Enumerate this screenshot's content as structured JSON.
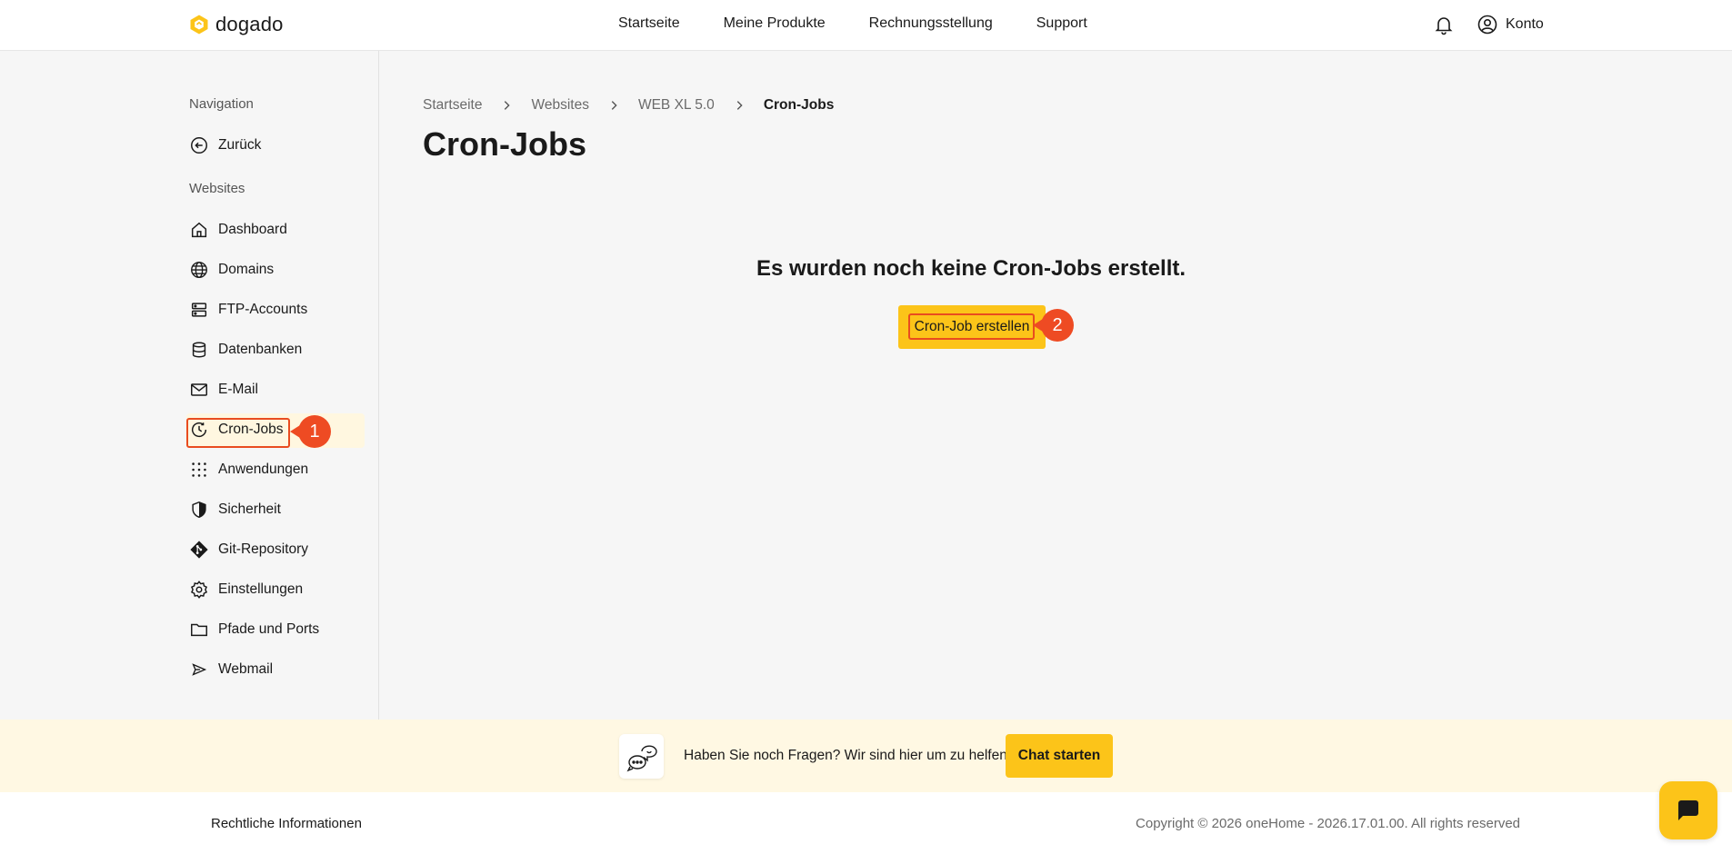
{
  "brand": {
    "name": "dogado",
    "accent": "#fcc419",
    "highlight": "#ee4b23"
  },
  "topnav": {
    "items": [
      "Startseite",
      "Meine Produkte",
      "Rechnungsstellung",
      "Support"
    ],
    "account_label": "Konto"
  },
  "sidebar": {
    "nav_label": "Navigation",
    "back_label": "Zurück",
    "section_label": "Websites",
    "items": [
      {
        "label": "Dashboard",
        "icon": "home-icon"
      },
      {
        "label": "Domains",
        "icon": "globe-icon"
      },
      {
        "label": "FTP-Accounts",
        "icon": "server-icon"
      },
      {
        "label": "Datenbanken",
        "icon": "database-icon"
      },
      {
        "label": "E-Mail",
        "icon": "mail-icon"
      },
      {
        "label": "Cron-Jobs",
        "icon": "cron-icon",
        "active": true
      },
      {
        "label": "Anwendungen",
        "icon": "grid-icon"
      },
      {
        "label": "Sicherheit",
        "icon": "shield-icon"
      },
      {
        "label": "Git-Repository",
        "icon": "git-icon"
      },
      {
        "label": "Einstellungen",
        "icon": "gear-icon"
      },
      {
        "label": "Pfade und Ports",
        "icon": "folder-icon"
      },
      {
        "label": "Webmail",
        "icon": "send-icon"
      }
    ]
  },
  "breadcrumb": [
    "Startseite",
    "Websites",
    "WEB XL 5.0",
    "Cron-Jobs"
  ],
  "main": {
    "title": "Cron-Jobs",
    "empty_message": "Es wurden noch keine Cron-Jobs erstellt.",
    "create_button": "Cron-Job erstellen"
  },
  "annotations": {
    "step1": "1",
    "step2": "2"
  },
  "help": {
    "text": "Haben Sie noch Fragen? Wir sind hier um zu helfen.",
    "button": "Chat starten"
  },
  "footer": {
    "legal": "Rechtliche Informationen",
    "copyright": "Copyright © 2026 oneHome - 2026.17.01.00. All rights reserved"
  }
}
